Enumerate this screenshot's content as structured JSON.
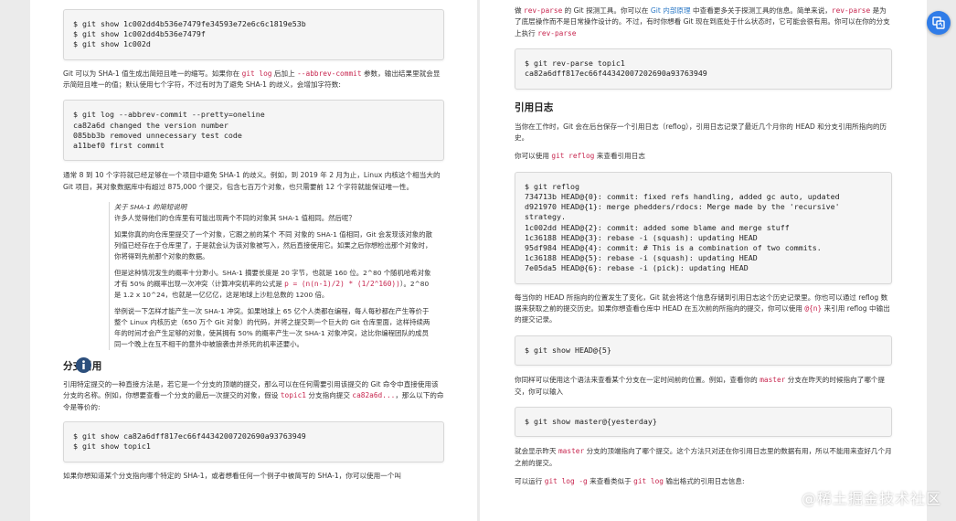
{
  "left": {
    "code1": "$ git show 1c002dd4b536e7479fe34593e72e6c6c1819e53b\n$ git show 1c002dd4b536e7479f\n$ git show 1c002d",
    "para1": {
      "a": "Git 可以为 SHA-1 值生成出简短且唯一的缩写。如果你在 ",
      "k1": "git log",
      "b": " 后加上 ",
      "k2": "--abbrev-commit",
      "c": " 参数，输出结果里就会显示简短且唯一的值；默认使用七个字符，不过有时为了避免 SHA-1 的歧义，会增加字符数:"
    },
    "code2": "$ git log --abbrev-commit --pretty=oneline\nca82a6d changed the version number\n085bb3b removed unnecessary test code\na11bef0 first commit",
    "para2": "通常 8 到 10 个字符就已经足够在一个项目中避免 SHA-1 的歧义。例如，到 2019 年 2 月为止，Linux 内核这个相当大的 Git 项目，其对象数据库中有超过 875,000 个提交，包含七百万个对象，也只需要前 12 个字符就能保证唯一性。",
    "note": {
      "title": "关于 SHA-1 的简短说明",
      "p1": "许多人觉得他们的仓库里有可能出现两个不同的对象其 SHA-1 值相同。然后呢？",
      "p2": "如果你真的向仓库里提交了一个对象，它跟之前的某个 不同 对象的 SHA-1 值相同，Git 会发现该对象的散列值已经存在于仓库里了，于是就会认为该对象被写入，然后直接使用它。如果之后你想检出那个对象时，你将得到先前那个对象的数据。",
      "p3a": "但是这种情况发生的概率十分渺小。SHA-1 摘要长度是 20 字节，也就是 160 位。2^80 个随机哈希对象才有 50% 的概率出现一次冲突（计算冲突机率的公式是 ",
      "p3k": "p = (n(n-1)/2) * (1/2^160))",
      "p3b": "）。2^80 是 1.2 x 10^24，也就是一亿亿亿，这是地球上沙粒总数的 1200 倍。",
      "p4": "举例说一下怎样才能产生一次 SHA-1 冲突。如果地球上 65 亿个人类都在编程，每人每秒都在产生等价于整个 Linux 内核历史（650 万个 Git 对象）的代码，并将之提交到一个巨大的 Git 仓库里面，这样持续两年的时间才会产生足够的对象，使其拥有 50% 的概率产生一次 SHA-1 对象冲突，这比你编程团队的成员同一个晚上在互不相干的意外中被狼袭击并杀死的机率还要小。"
    },
    "heading1": "分支引用",
    "para3": {
      "a": "引用特定提交的一种直接方法是，若它是一个分支的顶端的提交，那么可以在任何需要引用该提交的 Git 命令中直接使用该分支的名称。例如，你想要查看一个分支的最后一次提交的对象，假设 ",
      "k1": "topic1",
      "b": " 分支指向提交 ",
      "k2": "ca82a6d...",
      "c": "，那么以下的命令是等价的:"
    },
    "code3": "$ git show ca82a6dff817ec66f44342007202690a93763949\n$ git show topic1",
    "para4": "如果你想知道某个分支指向哪个特定的 SHA-1，或者想看任何一个例子中被简写的 SHA-1，你可以使用一个叫"
  },
  "right": {
    "para1": {
      "a": "做 ",
      "k1": "rev-parse",
      "b": " 的 Git 探测工具。你可以在 ",
      "link": "Git 内部原理",
      "c": " 中查看更多关于探测工具的信息。简单来说，",
      "k2": "rev-parse",
      "d": " 是为了底层操作而不是日常操作设计的。不过，有时你想看 Git 现在到底处于什么状态时，它可能会很有用。你可以在你的分支上执行 ",
      "k3": "rev-parse"
    },
    "code1": "$ git rev-parse topic1\nca82a6dff817ec66f44342007202690a93763949",
    "heading1": "引用日志",
    "para2": "当你在工作时，Git 会在后台保存一个引用日志（reflog），引用日志记录了最近几个月你的 HEAD 和分支引用所指向的历史。",
    "para3": {
      "a": "你可以使用 ",
      "k1": "git reflog",
      "b": " 来查看引用日志"
    },
    "code2": "$ git reflog\n734713b HEAD@{0}: commit: fixed refs handling, added gc auto, updated\nd921970 HEAD@{1}: merge phedders/rdocs: Merge made by the 'recursive' strategy.\n1c002dd HEAD@{2}: commit: added some blame and merge stuff\n1c36188 HEAD@{3}: rebase -i (squash): updating HEAD\n95df984 HEAD@{4}: commit: # This is a combination of two commits.\n1c36188 HEAD@{5}: rebase -i (squash): updating HEAD\n7e05da5 HEAD@{6}: rebase -i (pick): updating HEAD",
    "para4": {
      "a": "每当你的 HEAD 所指向的位置发生了变化，Git 就会将这个信息存储到引用日志这个历史记录里。你也可以通过 reflog 数据来获取之前的提交历史。如果你想查看仓库中 HEAD 在五次前的所指向的提交，你可以使用 ",
      "k1": "@{n}",
      "b": " 来引用 reflog 中输出的提交记录。"
    },
    "code3": "$ git show HEAD@{5}",
    "para5": {
      "a": "你同样可以使用这个语法来查看某个分支在一定时间前的位置。例如，查看你的 ",
      "k1": "master",
      "b": " 分支在昨天的时候指向了哪个提交，你可以输入"
    },
    "code4": "$ git show master@{yesterday}",
    "para6": {
      "a": "就会显示昨天 ",
      "k1": "master",
      "b": " 分支的顶端指向了哪个提交。这个方法只对还在你引用日志里的数据有用，所以不能用来查好几个月之前的提交。"
    },
    "para7": {
      "a": "可以运行 ",
      "k1": "git log -g",
      "b": " 来查看类似于 ",
      "k2": "git log",
      "c": " 输出格式的引用日志信息:"
    }
  },
  "watermark": "@稀土掘金技术社区",
  "icons": {
    "note": "info-icon",
    "fab": "translate-icon"
  },
  "colors": {
    "keyword": "#c7254e",
    "link": "#2b78c5",
    "info": "#2c4f7c",
    "fab": "#2f7ce8"
  }
}
